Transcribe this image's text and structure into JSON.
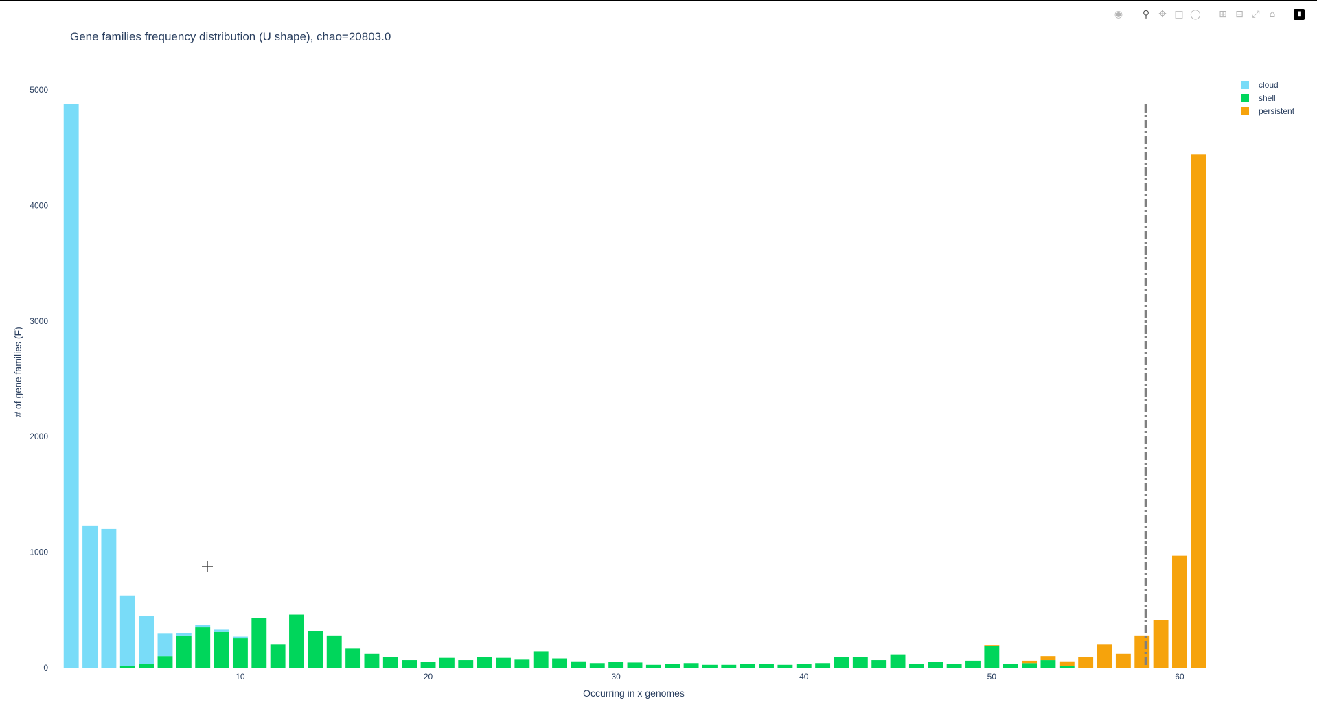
{
  "modebar": {
    "icons": [
      "camera-icon",
      "zoom-icon",
      "pan-icon",
      "box-select-icon",
      "lasso-select-icon",
      "zoom-in-icon",
      "zoom-out-icon",
      "autoscale-icon",
      "reset-axes-icon",
      "plotly-logo-icon"
    ]
  },
  "chart_data": {
    "type": "bar",
    "barmode": "stack",
    "title": "Gene families frequency distribution (U shape), chao=20803.0",
    "xlabel": "Occurring in x genomes",
    "ylabel": "# of gene families (F)",
    "xlim": [
      0.5,
      61.5
    ],
    "ylim": [
      0,
      5000
    ],
    "xticks": [
      10,
      20,
      30,
      40,
      50,
      60
    ],
    "yticks": [
      0,
      1000,
      2000,
      3000,
      4000,
      5000
    ],
    "legend_position": "top-right",
    "x": [
      1,
      2,
      3,
      4,
      5,
      6,
      7,
      8,
      9,
      10,
      11,
      12,
      13,
      14,
      15,
      16,
      17,
      18,
      19,
      20,
      21,
      22,
      23,
      24,
      25,
      26,
      27,
      28,
      29,
      30,
      31,
      32,
      33,
      34,
      35,
      36,
      37,
      38,
      39,
      40,
      41,
      42,
      43,
      44,
      45,
      46,
      47,
      48,
      49,
      50,
      51,
      52,
      53,
      54,
      55,
      56,
      57,
      58,
      59,
      60,
      61
    ],
    "series": [
      {
        "name": "shell",
        "color": "#00d65b",
        "values": [
          0,
          0,
          0,
          15,
          30,
          100,
          280,
          350,
          310,
          255,
          430,
          200,
          460,
          320,
          280,
          170,
          120,
          90,
          65,
          50,
          85,
          65,
          95,
          85,
          75,
          140,
          80,
          55,
          40,
          50,
          45,
          25,
          35,
          40,
          25,
          25,
          30,
          30,
          25,
          30,
          40,
          95,
          95,
          65,
          115,
          30,
          50,
          35,
          60,
          185,
          30,
          40,
          65,
          15,
          0,
          0,
          0,
          0,
          0,
          0,
          0
        ]
      },
      {
        "name": "cloud",
        "color": "#79dcf8",
        "values": [
          4880,
          1230,
          1200,
          610,
          420,
          195,
          20,
          20,
          20,
          15,
          0,
          0,
          0,
          0,
          0,
          0,
          0,
          0,
          0,
          0,
          0,
          0,
          0,
          0,
          0,
          0,
          0,
          0,
          0,
          0,
          0,
          0,
          0,
          0,
          0,
          0,
          0,
          0,
          0,
          0,
          0,
          0,
          0,
          0,
          0,
          0,
          0,
          0,
          0,
          0,
          0,
          0,
          0,
          0,
          0,
          0,
          0,
          0,
          0,
          0,
          0
        ]
      },
      {
        "name": "persistent",
        "color": "#f6a30c",
        "values": [
          0,
          0,
          0,
          0,
          0,
          0,
          0,
          0,
          0,
          0,
          0,
          0,
          0,
          0,
          0,
          0,
          0,
          0,
          0,
          0,
          0,
          0,
          0,
          0,
          0,
          0,
          0,
          0,
          0,
          0,
          0,
          0,
          0,
          0,
          0,
          0,
          0,
          0,
          0,
          0,
          0,
          0,
          0,
          0,
          0,
          0,
          0,
          0,
          0,
          10,
          0,
          20,
          35,
          40,
          90,
          200,
          120,
          280,
          415,
          970,
          4440
        ]
      }
    ],
    "threshold_line": {
      "x": 58.2,
      "style": "dashdot",
      "color": "#7f7f7f"
    }
  }
}
